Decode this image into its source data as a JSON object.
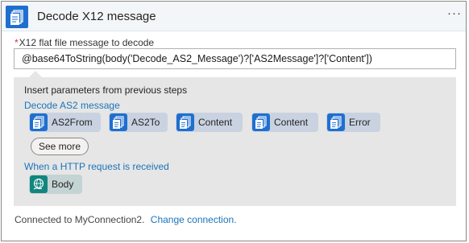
{
  "header": {
    "title": "Decode X12 message",
    "icon": "document-stack-icon",
    "more_label": "···"
  },
  "field": {
    "required_marker": "*",
    "label": "X12 flat file message to decode",
    "value": "@base64ToString(body('Decode_AS2_Message')?['AS2Message']?['Content'])"
  },
  "panel": {
    "title": "Insert parameters from previous steps",
    "groups": [
      {
        "name": "Decode AS2 message",
        "tokens": [
          {
            "label": "AS2From",
            "icon": "document-stack-icon"
          },
          {
            "label": "AS2To",
            "icon": "document-stack-icon"
          },
          {
            "label": "Content",
            "icon": "document-stack-icon"
          },
          {
            "label": "Content",
            "icon": "document-stack-icon"
          },
          {
            "label": "Error",
            "icon": "document-stack-icon"
          }
        ],
        "see_more": "See more"
      },
      {
        "name": "When a HTTP request is received",
        "tokens": [
          {
            "label": "Body",
            "icon": "globe-hand-icon"
          }
        ]
      }
    ]
  },
  "footer": {
    "connected_text": "Connected to MyConnection2.",
    "change_link": "Change connection."
  },
  "colors": {
    "accent_blue": "#1f6fcf",
    "link_blue": "#1c74b9",
    "http_teal": "#12867e",
    "required_red": "#d13438",
    "panel_gray": "#e6e6e6"
  }
}
